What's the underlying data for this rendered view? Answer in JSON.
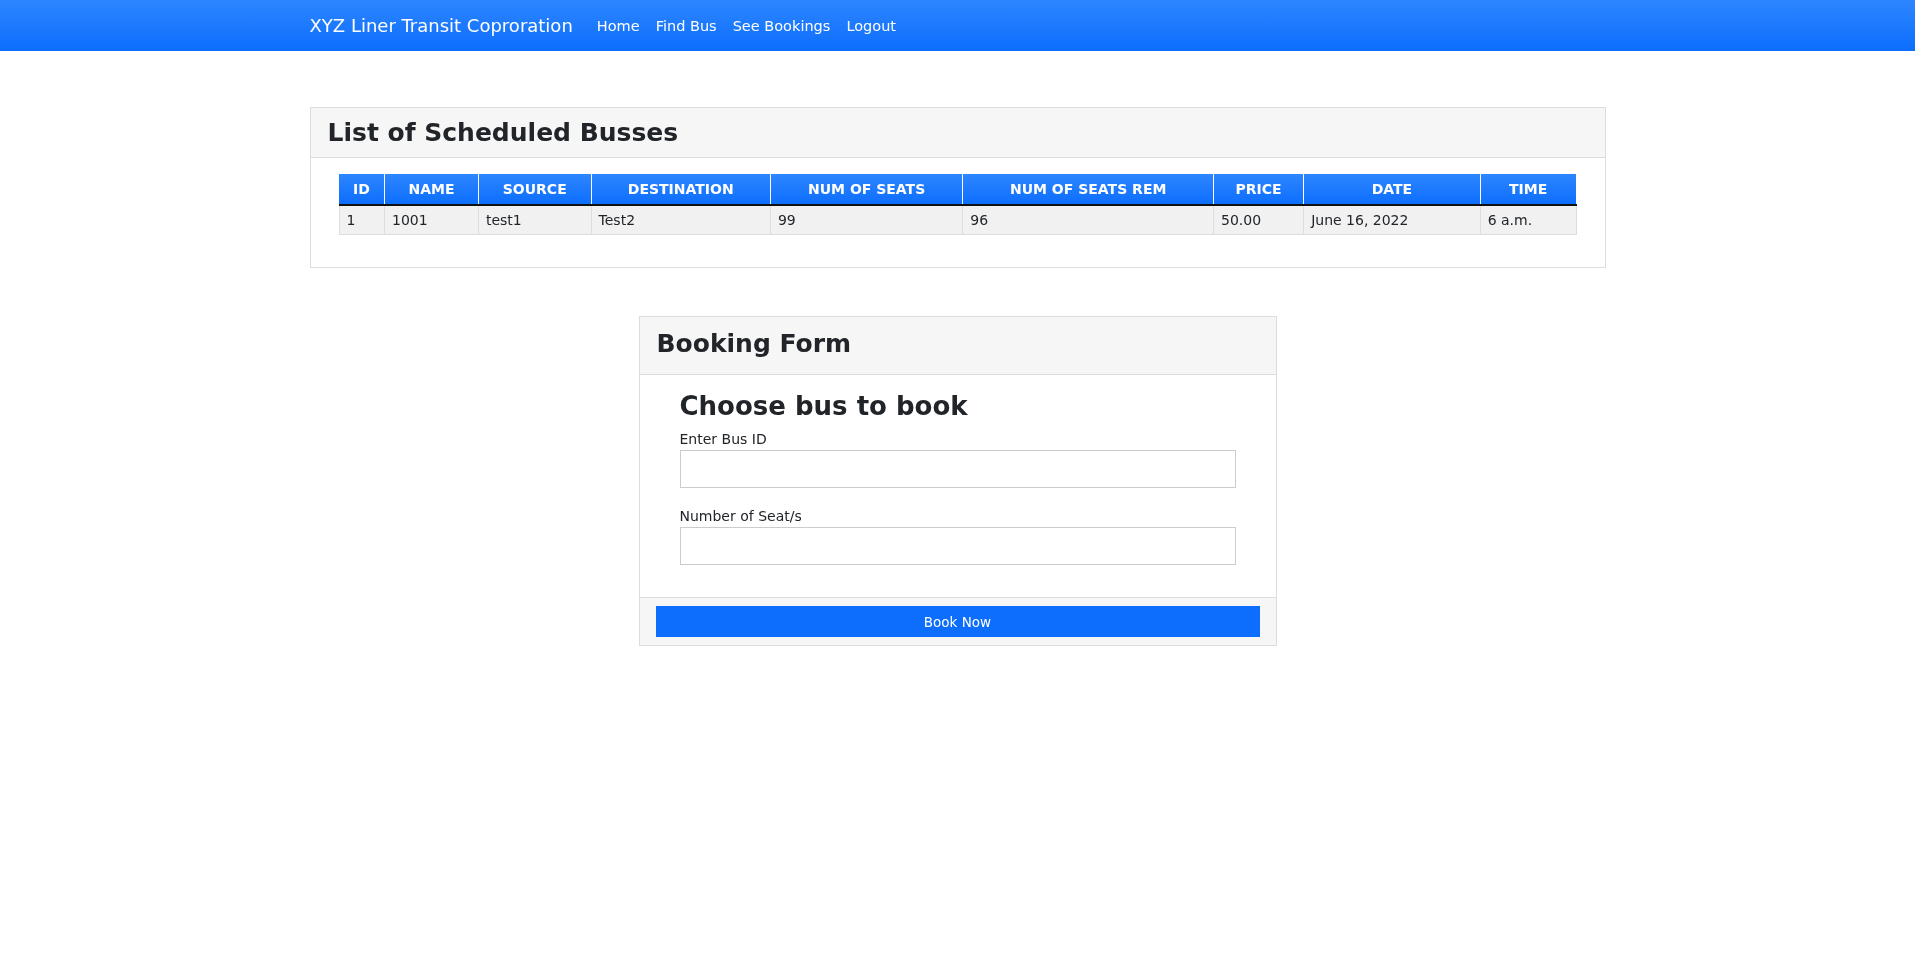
{
  "navbar": {
    "brand": "XYZ Liner Transit Coproration",
    "links": [
      "Home",
      "Find Bus",
      "See Bookings",
      "Logout"
    ]
  },
  "bus_list": {
    "title": "List of Scheduled Busses",
    "table": {
      "columns": [
        "ID",
        "NAME",
        "SOURCE",
        "DESTINATION",
        "NUM OF SEATS",
        "NUM OF SEATS REM",
        "PRICE",
        "DATE",
        "TIME"
      ],
      "rows": [
        [
          "1",
          "1001",
          "test1",
          "Test2",
          "99",
          "96",
          "50.00",
          "June 16, 2022",
          "6 a.m."
        ]
      ]
    }
  },
  "booking_form": {
    "title": "Booking Form",
    "heading": "Choose bus to book",
    "fields": [
      {
        "label": "Enter Bus ID"
      },
      {
        "label": "Number of Seat/s"
      }
    ],
    "button": "Book Now"
  }
}
